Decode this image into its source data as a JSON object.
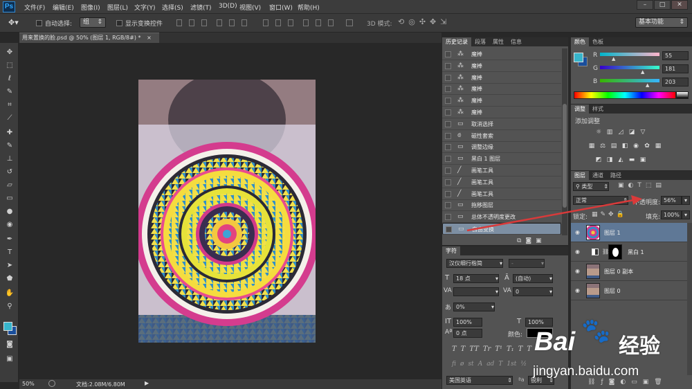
{
  "app": {
    "logo": "Ps",
    "menus": [
      "文件(F)",
      "编辑(E)",
      "图像(I)",
      "图层(L)",
      "文字(Y)",
      "选择(S)",
      "滤镜(T)",
      "3D(D)",
      "视图(V)",
      "窗口(W)",
      "帮助(H)"
    ],
    "window_buttons": [
      "–",
      "□",
      "✕"
    ]
  },
  "options": {
    "auto_select_label": "自动选择:",
    "auto_select_value": "组",
    "show_transform_label": "显示变换控件",
    "mode_3d_label": "3D 模式:",
    "workspace": "基本功能"
  },
  "document": {
    "tab_title": "用来置换的脸.psd @ 50% (图层 1, RGB/8#) *",
    "close": "×"
  },
  "status": {
    "zoom": "50%",
    "doc_size": "文档:2.08M/6.80M"
  },
  "history": {
    "tabs": [
      "历史记录",
      "段落",
      "属性",
      "信息"
    ],
    "items": [
      {
        "icon": "magic-wand-icon",
        "label": "魔棒"
      },
      {
        "icon": "magic-wand-icon",
        "label": "魔棒"
      },
      {
        "icon": "magic-wand-icon",
        "label": "魔棒"
      },
      {
        "icon": "magic-wand-icon",
        "label": "魔棒"
      },
      {
        "icon": "magic-wand-icon",
        "label": "魔棒"
      },
      {
        "icon": "magic-wand-icon",
        "label": "魔棒"
      },
      {
        "icon": "history-state-icon",
        "label": "取消选择"
      },
      {
        "icon": "magnetic-lasso-icon",
        "label": "磁性套索"
      },
      {
        "icon": "history-state-icon",
        "label": "调整边缘"
      },
      {
        "icon": "history-state-icon",
        "label": "黑白 1 图层"
      },
      {
        "icon": "brush-icon",
        "label": "画笔工具"
      },
      {
        "icon": "brush-icon",
        "label": "画笔工具"
      },
      {
        "icon": "brush-icon",
        "label": "画笔工具"
      },
      {
        "icon": "history-state-icon",
        "label": "拖移图层"
      },
      {
        "icon": "history-state-icon",
        "label": "总体不透明度更改"
      },
      {
        "icon": "history-state-icon",
        "label": "自由变换"
      }
    ],
    "selected_index": 15
  },
  "character": {
    "tab": "字符",
    "font_family": "汉仪细行楷简",
    "font_style": "-",
    "size": "18 点",
    "leading": "(自动)",
    "kerning": "",
    "tracking": "0",
    "scale_pct": "0%",
    "vscale": "100%",
    "hscale": "100%",
    "baseline": "0 点",
    "color_label": "颜色:",
    "typo_buttons": [
      "T",
      "T",
      "TT",
      "Tr",
      "T¹",
      "T₁",
      "T",
      "T"
    ],
    "ot_buttons": [
      "fi",
      "ø",
      "st",
      "A",
      "ad",
      "T",
      "1st",
      "½"
    ],
    "language": "美国英语",
    "antialias": "锐利"
  },
  "color_panel": {
    "tabs": [
      "颜色",
      "色板"
    ],
    "fg_color": "#37b5cb",
    "channels": [
      {
        "label": "R",
        "value": "55",
        "fraction": 0.216
      },
      {
        "label": "G",
        "value": "181",
        "fraction": 0.71
      },
      {
        "label": "B",
        "value": "203",
        "fraction": 0.796
      }
    ]
  },
  "adjustments": {
    "tabs": [
      "调整",
      "样式"
    ],
    "title": "添加调整"
  },
  "layers": {
    "tabs": [
      "图层",
      "通道",
      "路径"
    ],
    "filter_label": "类型",
    "blend_mode": "正常",
    "opacity_label": "不透明度:",
    "opacity_value": "56%",
    "lock_label": "锁定:",
    "fill_label": "填充:",
    "fill_value": "100%",
    "items": [
      {
        "name": "图层 1",
        "thumb": "mandala-thumbnail",
        "selected": true
      },
      {
        "name": "黑白 1",
        "thumb": "adjustment-mask-thumbnail",
        "selected": false
      },
      {
        "name": "图层 0 副本",
        "thumb": "face-thumbnail",
        "selected": false
      },
      {
        "name": "图层 0",
        "thumb": "face-thumbnail",
        "selected": false
      }
    ],
    "footer_icons": [
      "link-icon",
      "fx-icon",
      "mask-icon",
      "adjustment-icon",
      "folder-icon",
      "new-layer-icon",
      "trash-icon"
    ]
  },
  "watermark": {
    "brand": "Bai",
    "brand_cn": "经验",
    "url": "jingyan.baidu.com"
  },
  "annotation": {
    "arrow_color": "#d93a3a"
  }
}
